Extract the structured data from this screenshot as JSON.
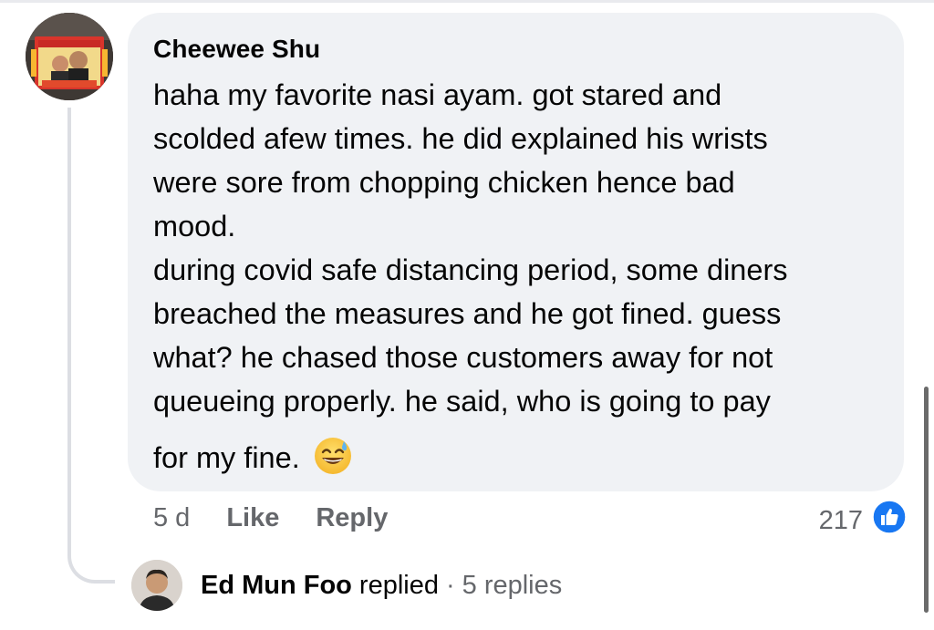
{
  "comment": {
    "author": "Cheewee Shu",
    "lines": [
      "haha my favorite nasi ayam. got stared and",
      "scolded afew times. he did explained his wrists",
      "were sore from chopping chicken hence bad",
      "mood.",
      "during covid safe distancing period, some diners",
      "breached the measures and he got fined. guess",
      "what? he chased those customers away for not",
      "queueing properly. he said, who is going to pay"
    ],
    "last_line": "for my fine.",
    "emoji": "sweat-smile-emoji",
    "time": "5 d",
    "like_label": "Like",
    "reply_label": "Reply",
    "reaction_count": "217",
    "reaction_icon": "like-icon"
  },
  "replies": {
    "name": "Ed Mun Foo",
    "action": "replied",
    "separator": "·",
    "count_label": "5 replies"
  },
  "colors": {
    "bubble": "#f0f2f5",
    "muted_text": "#65676b",
    "like_blue": "#1877f2",
    "thread_line": "#dcdee3"
  }
}
